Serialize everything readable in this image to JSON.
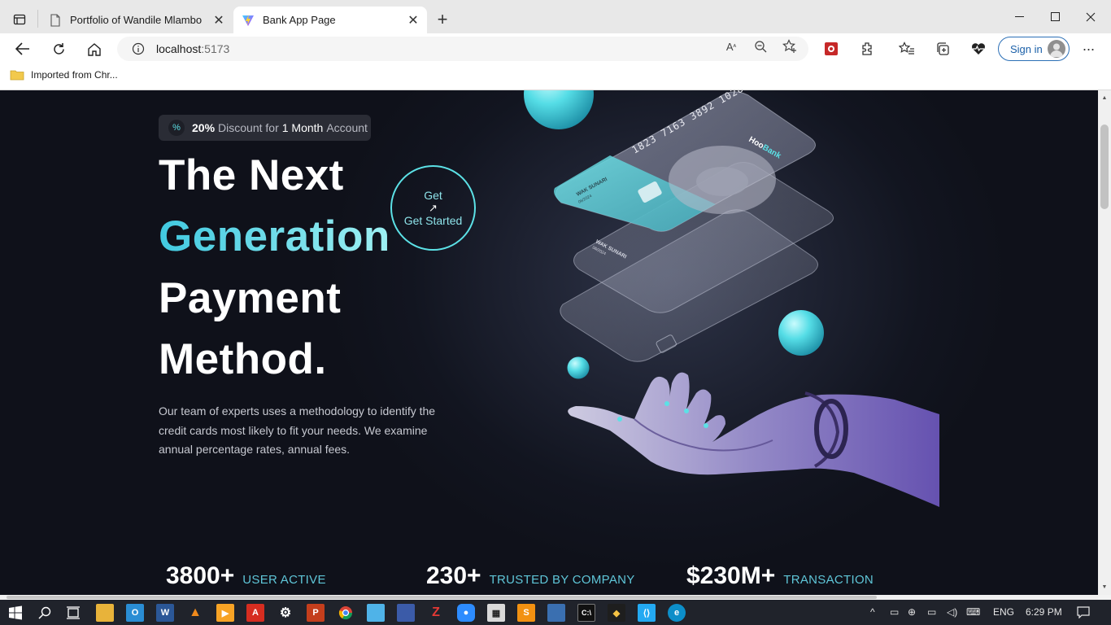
{
  "browser": {
    "tabs": [
      {
        "label": "Portfolio of Wandile Mlambo",
        "active": false
      },
      {
        "label": "Bank App Page",
        "active": true
      }
    ],
    "url_host": "localhost",
    "url_port": ":5173",
    "favorites": [
      {
        "label": "Imported from Chr..."
      }
    ],
    "signin_label": "Sign in"
  },
  "page": {
    "discount": {
      "percent": "20%",
      "text1": "Discount for",
      "highlight": "1 Month",
      "text2": "Account"
    },
    "headline": {
      "line1": "The Next",
      "line2": "Generation",
      "line3": "Payment",
      "line4": "Method."
    },
    "cta": {
      "top": "Get",
      "arrow": "↗",
      "label": "Get Started"
    },
    "paragraph": "Our team of experts uses a methodology to identify the credit cards most likely to fit your needs. We examine annual percentage rates, annual fees.",
    "cards": {
      "number": "1823 7163 3892 1028",
      "brand_prefix": "Hoo",
      "brand_suffix": "Bank",
      "holder": "WAK SUNARI",
      "date": "06/2024"
    },
    "stats": [
      {
        "value": "3800+",
        "label": "USER ACTIVE"
      },
      {
        "value": "230+",
        "label": "TRUSTED BY COMPANY"
      },
      {
        "value": "$230M+",
        "label": "TRANSACTION"
      }
    ]
  },
  "taskbar": {
    "language": "ENG",
    "time": "6:29 PM"
  },
  "colors": {
    "accent": "#5ce1e6",
    "page_bg": "#0f111a"
  }
}
